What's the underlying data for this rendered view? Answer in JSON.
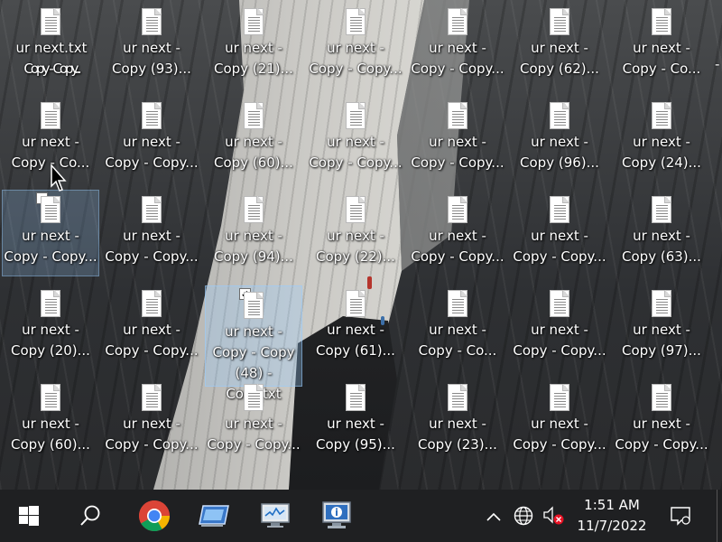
{
  "desktop": {
    "icons": [
      {
        "line1": "ur next - ",
        "line2": "Copy (93)..."
      },
      {
        "line1": "ur next - ",
        "line2": "Copy (21)..."
      },
      {
        "line1": "ur next - ",
        "line2": "Copy - Copy..."
      },
      {
        "line1": "ur next - ",
        "line2": "Copy - Copy..."
      },
      {
        "line1": "ur next - ",
        "line2": "Copy (62)..."
      },
      {
        "line1": "ur next - ",
        "line2": "Copy - Co..."
      },
      {
        "line1": "ur next - ",
        "line2": "Copy - Co..."
      },
      {
        "line1": "ur next - ",
        "line2": "Copy - Copy..."
      },
      {
        "line1": "ur next - ",
        "line2": "Copy (60)..."
      },
      {
        "line1": "ur next - ",
        "line2": "Copy - Copy..."
      },
      {
        "line1": "ur next - ",
        "line2": "Copy - Copy..."
      },
      {
        "line1": "ur next - ",
        "line2": "Copy (96)..."
      },
      {
        "line1": "ur next - ",
        "line2": "Copy (24)..."
      },
      {
        "line1": "ur next - ",
        "line2": "Copy - Copy..."
      },
      {
        "line1": "ur next - ",
        "line2": "Copy - Copy..."
      },
      {
        "line1": "ur next - ",
        "line2": "Copy (94)..."
      },
      {
        "line1": "ur next - ",
        "line2": "Copy (22)..."
      },
      {
        "line1": "ur next - ",
        "line2": "Copy - Copy..."
      },
      {
        "line1": "ur next - ",
        "line2": "Copy - Copy..."
      },
      {
        "line1": "ur next - ",
        "line2": "Copy (63)..."
      },
      {
        "line1": "ur next - ",
        "line2": "Copy (20)..."
      },
      {
        "line1": "ur next - ",
        "line2": "Copy - Copy..."
      },
      {
        "line1": "ur next - ",
        "line2": "Copy - Copy",
        "line3": "(48) - Copy.txt"
      },
      {
        "line1": "ur next - ",
        "line2": "Copy (61)..."
      },
      {
        "line1": "ur next - ",
        "line2": "Copy - Co..."
      },
      {
        "line1": "ur next - ",
        "line2": "Copy - Copy..."
      },
      {
        "line1": "ur next - ",
        "line2": "Copy (97)..."
      },
      {
        "line1": "ur next - ",
        "line2": "Copy (60)..."
      },
      {
        "line1": "ur next - ",
        "line2": "Copy - Copy..."
      },
      {
        "line1": "ur next - ",
        "line2": "Copy - Copy..."
      },
      {
        "line1": "ur next - ",
        "line2": "Copy (95)..."
      },
      {
        "line1": "ur next - ",
        "line2": "Copy (23)..."
      },
      {
        "line1": "ur next - ",
        "line2": "Copy - Copy..."
      },
      {
        "line1": "ur next - ",
        "line2": "Copy - Copy..."
      }
    ],
    "glitched_icon": {
      "line1": "ur next.txt",
      "line2": "Copy - Copy..."
    },
    "right_partial_label": "-",
    "checked_mark": "✓"
  },
  "taskbar": {
    "start_icon": "windows-logo-icon",
    "search_icon": "search-icon",
    "apps": [
      "chrome-icon",
      "remote-desktop-icon",
      "performance-monitor-icon",
      "system-information-icon"
    ],
    "tray": {
      "chevron": "^",
      "network_icon": "globe-icon",
      "volume_icon": "volume-muted-icon",
      "notification_icon": "notification-icon"
    },
    "time": "1:51 AM",
    "date": "11/7/2022"
  }
}
